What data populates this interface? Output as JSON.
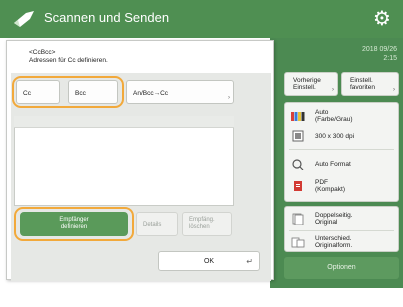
{
  "header": {
    "title": "Scannen und Senden",
    "settings_icon": "gear-icon"
  },
  "status": {
    "date": "2018 09/26",
    "time": "2:15"
  },
  "dialog": {
    "title_line1": "<CcBcc>",
    "title_line2": "Adressen für Cc definieren.",
    "tabs": {
      "cc": "Cc",
      "bcc": "Bcc",
      "select": "An/Bcc→Cc"
    },
    "register_button": "Empfänger definieren",
    "details_button": "Details",
    "remove_button": "Empfäng. löschen",
    "ok_button": "OK"
  },
  "right_panel": {
    "prev_settings": "Vorherige Einstell.",
    "favorites": "Einstell. favoriten",
    "color_mode": "Auto (Farbe/Grau)",
    "resolution": "300 x 300 dpi",
    "scan_size": "Auto Format",
    "file_format": "PDF (Kompakt)",
    "duplex": "Doppelseitig. Original",
    "mixed_sizes": "Unterschied. Originalform.",
    "options": "Optionen"
  },
  "colors": {
    "brand_green": "#4f8f52",
    "highlight_orange": "#f2a93b"
  }
}
